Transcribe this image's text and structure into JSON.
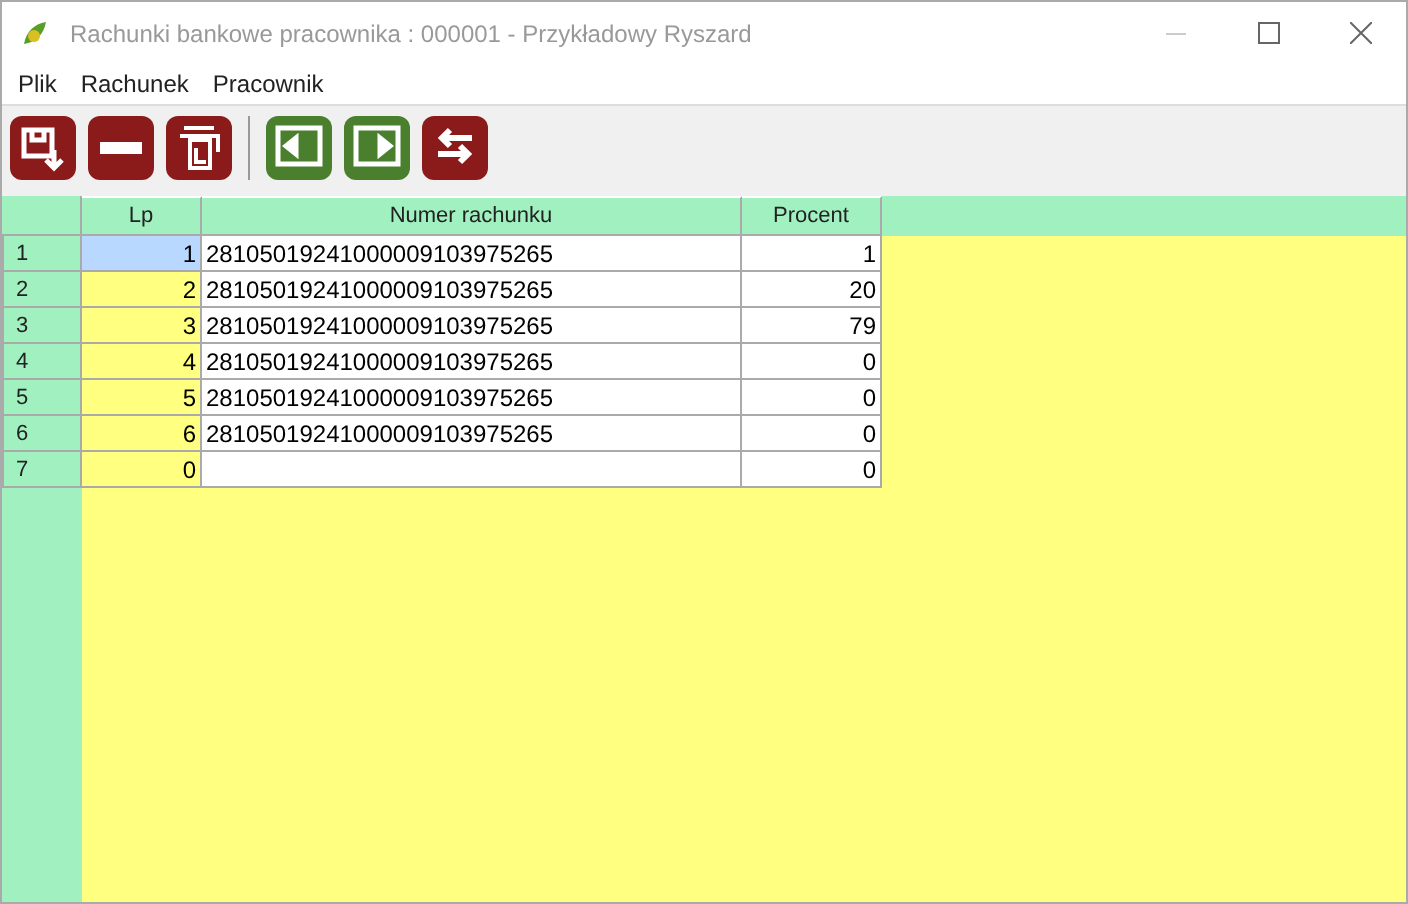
{
  "window": {
    "title": "Rachunki bankowe pracownika : 000001 - Przykładowy Ryszard"
  },
  "menu": [
    "Plik",
    "Rachunek",
    "Pracownik"
  ],
  "toolbar": [
    {
      "kind": "save",
      "color": "#8b1a1a"
    },
    {
      "kind": "remove",
      "color": "#8b1a1a"
    },
    {
      "kind": "print",
      "color": "#8b1a1a"
    },
    {
      "kind": "separator"
    },
    {
      "kind": "prev",
      "color": "#4a7f2e"
    },
    {
      "kind": "next",
      "color": "#4a7f2e"
    },
    {
      "kind": "swap",
      "color": "#8b1a1a"
    }
  ],
  "table": {
    "columns": [
      "Lp",
      "Numer rachunku",
      "Procent"
    ],
    "rows": [
      {
        "header": "1",
        "lp": "1",
        "account": "28105019241000009103975265",
        "percent": "1",
        "selected": true
      },
      {
        "header": "2",
        "lp": "2",
        "account": "28105019241000009103975265",
        "percent": "20",
        "selected": false
      },
      {
        "header": "3",
        "lp": "3",
        "account": "28105019241000009103975265",
        "percent": "79",
        "selected": false
      },
      {
        "header": "4",
        "lp": "4",
        "account": "28105019241000009103975265",
        "percent": "0",
        "selected": false
      },
      {
        "header": "5",
        "lp": "5",
        "account": "28105019241000009103975265",
        "percent": "0",
        "selected": false
      },
      {
        "header": "6",
        "lp": "6",
        "account": "28105019241000009103975265",
        "percent": "0",
        "selected": false
      },
      {
        "header": "7",
        "lp": "0",
        "percent": "0",
        "selected": false
      }
    ]
  }
}
